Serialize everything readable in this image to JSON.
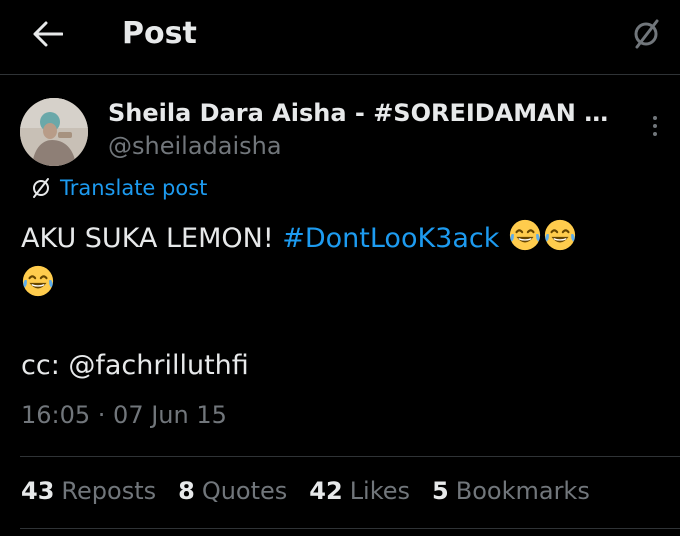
{
  "header": {
    "title": "Post",
    "back_icon": "arrow-left-icon",
    "translate_icon": "translate-slash-icon"
  },
  "author": {
    "display_name": "Sheila Dara Aisha - #SOREIDAMAN DI...",
    "handle": "@sheiladaisha",
    "avatar_icon": "avatar-photo"
  },
  "translate": {
    "label": "Translate post",
    "icon": "translate-slash-icon"
  },
  "post": {
    "text_before": "AKU SUKA LEMON! ",
    "hashtag": "#DontLooK3ack",
    "emoji_icon": "face-with-tears-of-joy-icon",
    "cc_line": "cc: @fachrilluthfi",
    "timestamp": "16:05 · 07 Jun 15"
  },
  "stats": [
    {
      "count": "43",
      "label": "Reposts"
    },
    {
      "count": "8",
      "label": "Quotes"
    },
    {
      "count": "42",
      "label": "Likes"
    },
    {
      "count": "5",
      "label": "Bookmarks"
    }
  ],
  "colors": {
    "background": "#000000",
    "text": "#e7e9ea",
    "muted": "#71767b",
    "accent": "#1d9bf0",
    "divider": "#2f3336"
  }
}
